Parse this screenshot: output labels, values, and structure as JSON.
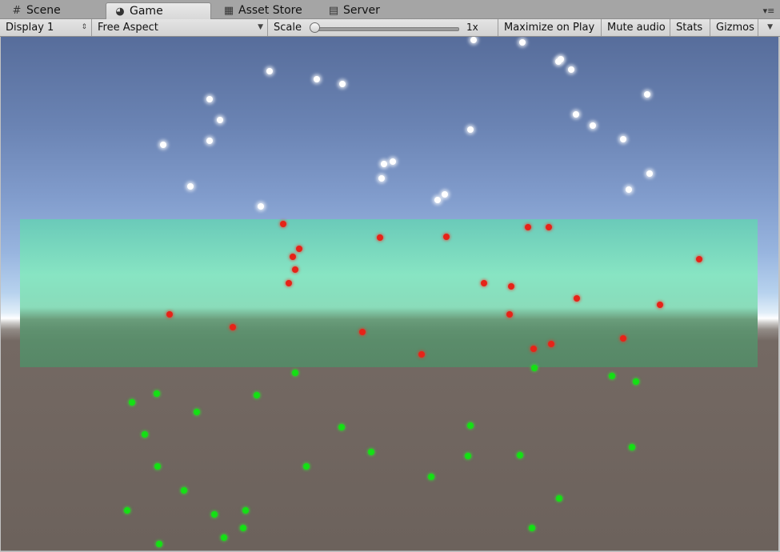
{
  "tabs": [
    {
      "label": "Scene",
      "icon": "grid-icon",
      "active": false
    },
    {
      "label": "Game",
      "icon": "pacman-icon",
      "active": true
    },
    {
      "label": "Asset Store",
      "icon": "shopping-bag-icon",
      "active": false
    },
    {
      "label": "Server",
      "icon": "server-icon",
      "active": false
    }
  ],
  "toolbar": {
    "display": "Display 1",
    "aspect": "Free Aspect",
    "scale_label": "Scale",
    "scale_value": "1x",
    "scale_fraction": 0.0,
    "maximize": "Maximize on Play",
    "mute": "Mute audio",
    "stats": "Stats",
    "gizmos": "Gizmos"
  },
  "scene": {
    "colors": {
      "white_particles": "#ffffff",
      "red_particles": "#e62318",
      "green_particles": "#14e014",
      "zone": "#7fe0bf",
      "sky_top": "#576d9b",
      "ground": "#6c625c"
    }
  }
}
